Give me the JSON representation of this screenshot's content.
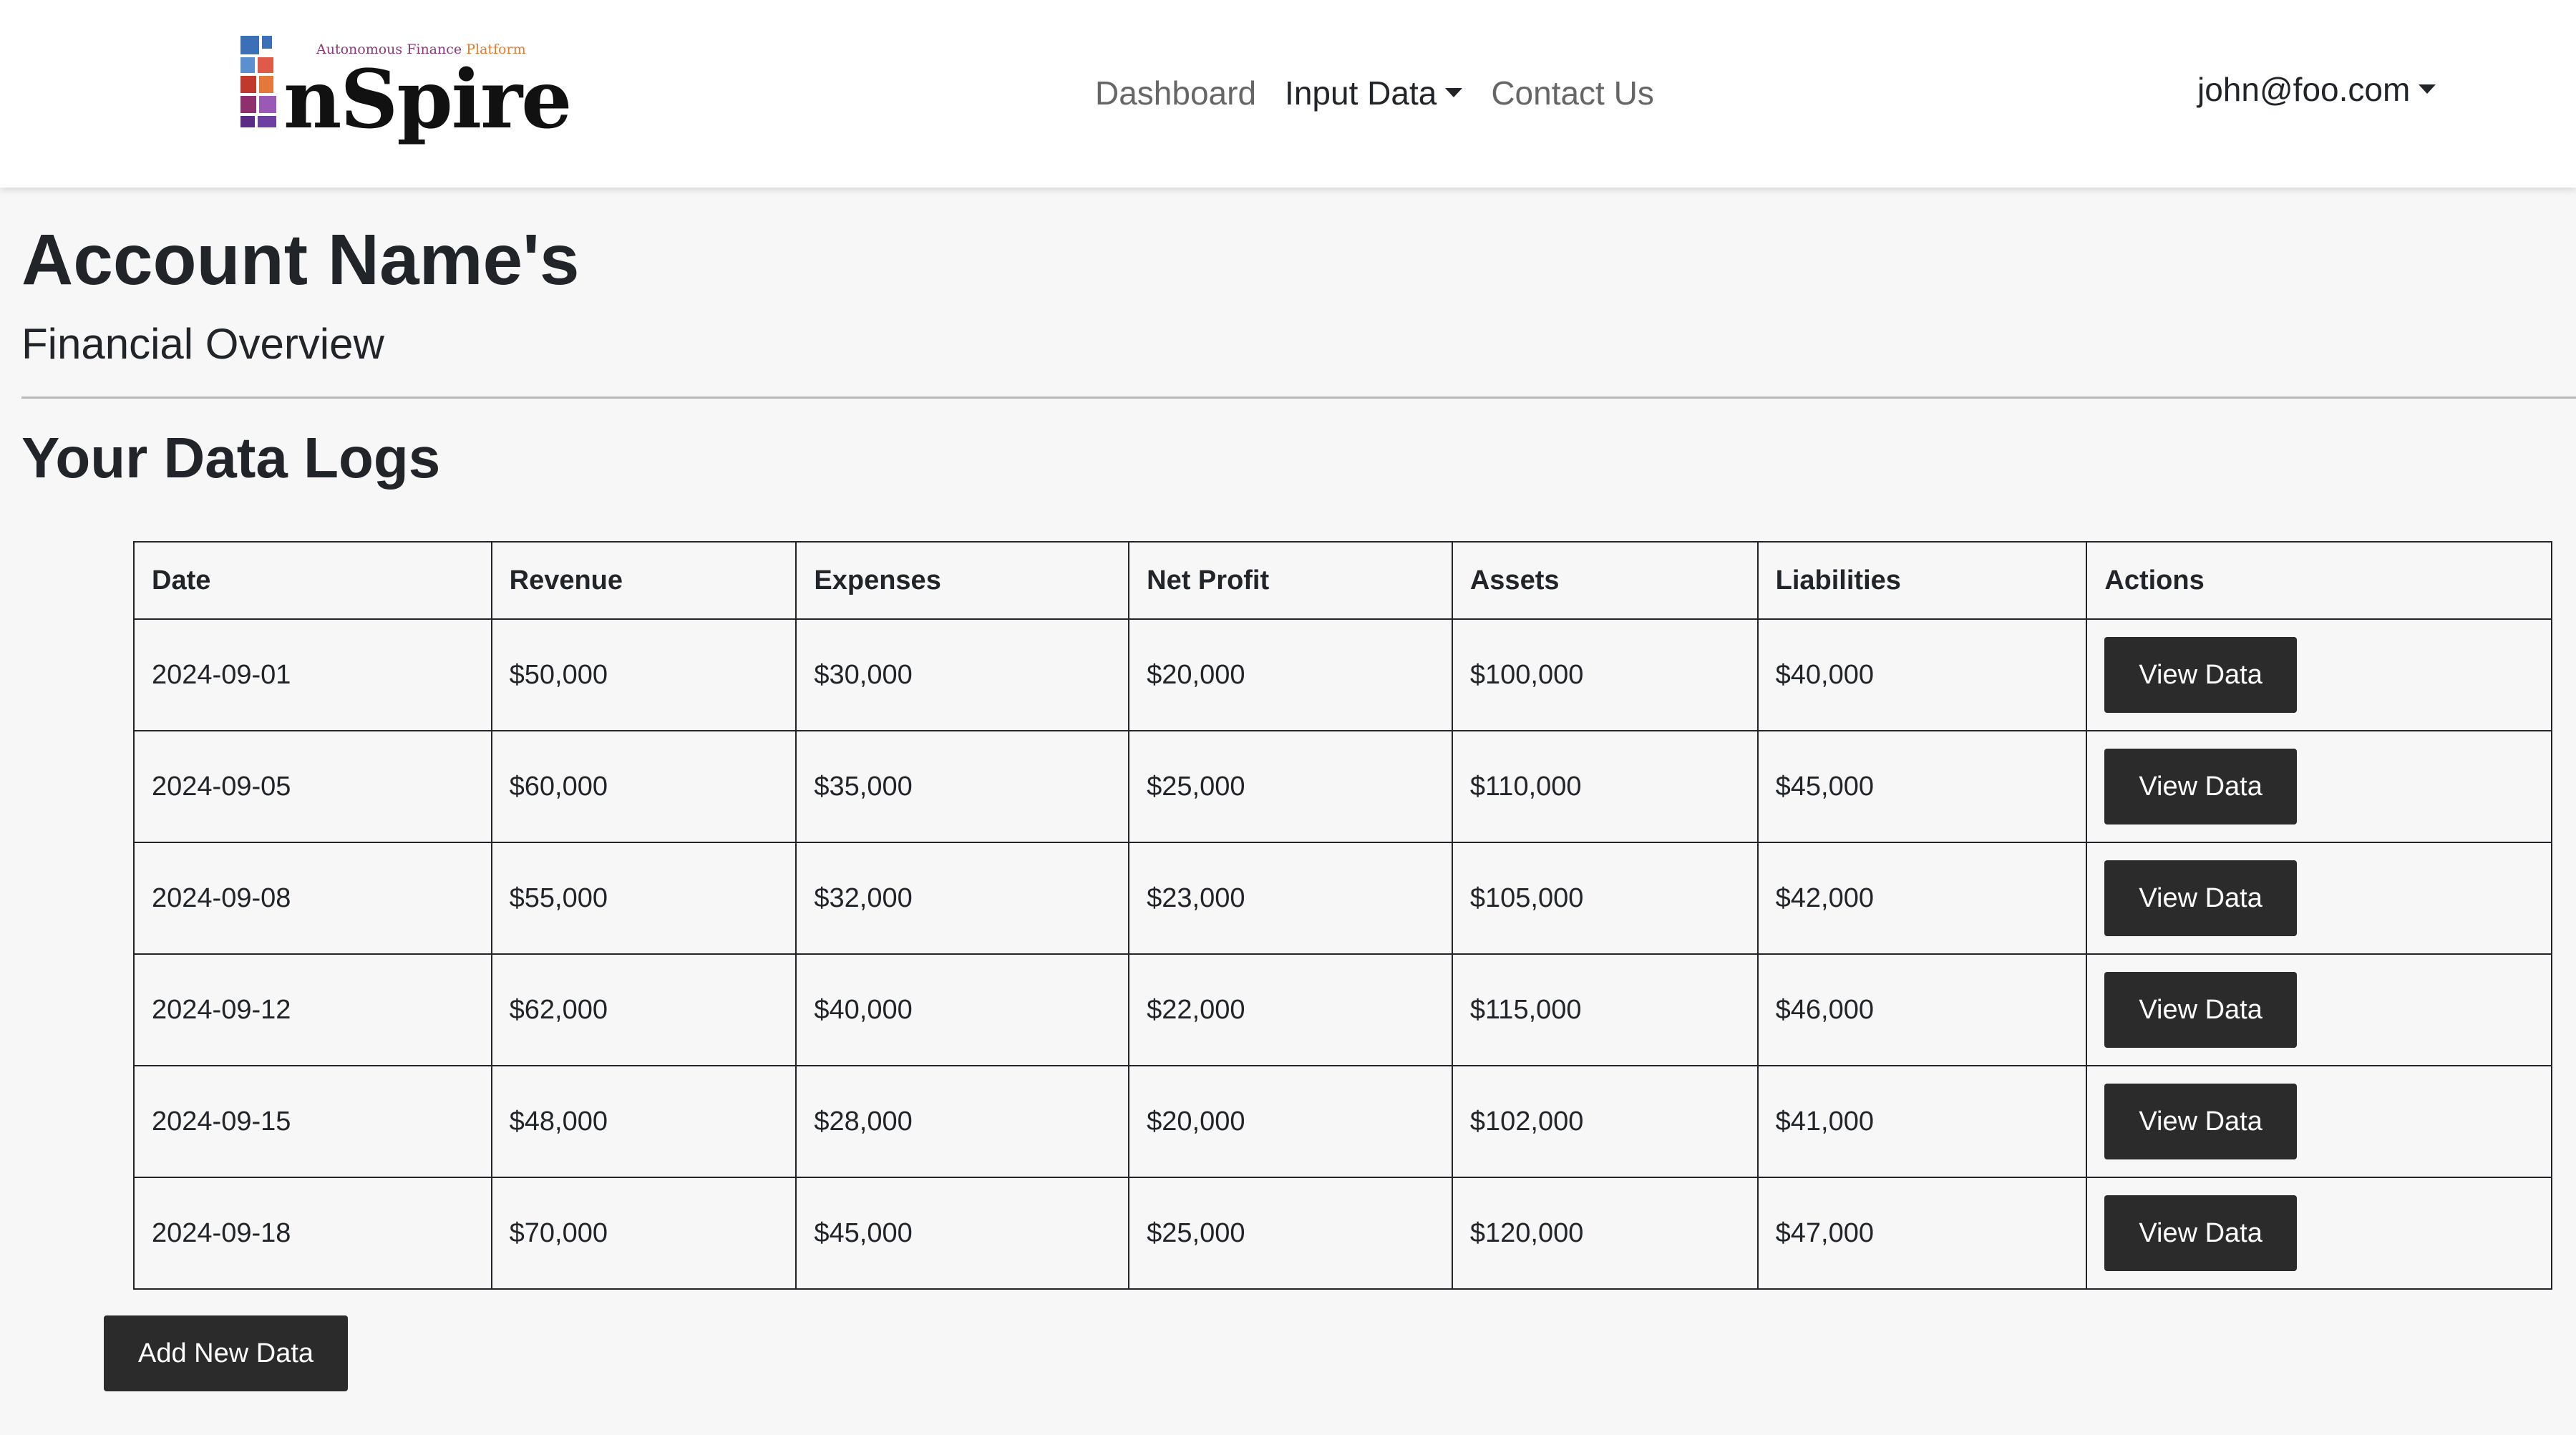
{
  "header": {
    "logo": {
      "tagline_part1": "Autonomous Finance",
      "tagline_part2": "Platform",
      "wordmark": "nSpire"
    },
    "nav": [
      {
        "label": "Dashboard",
        "active": false,
        "dropdown": false
      },
      {
        "label": "Input Data",
        "active": true,
        "dropdown": true
      },
      {
        "label": "Contact Us",
        "active": false,
        "dropdown": false
      }
    ],
    "user_email": "john@foo.com"
  },
  "page": {
    "title": "Account Name's",
    "subtitle": "Financial Overview",
    "section_title": "Your Data Logs"
  },
  "table": {
    "columns": [
      "Date",
      "Revenue",
      "Expenses",
      "Net Profit",
      "Assets",
      "Liabilities",
      "Actions"
    ],
    "rows": [
      [
        "2024-09-01",
        "$50,000",
        "$30,000",
        "$20,000",
        "$100,000",
        "$40,000"
      ],
      [
        "2024-09-05",
        "$60,000",
        "$35,000",
        "$25,000",
        "$110,000",
        "$45,000"
      ],
      [
        "2024-09-08",
        "$55,000",
        "$32,000",
        "$23,000",
        "$105,000",
        "$42,000"
      ],
      [
        "2024-09-12",
        "$62,000",
        "$40,000",
        "$22,000",
        "$115,000",
        "$46,000"
      ],
      [
        "2024-09-15",
        "$48,000",
        "$28,000",
        "$20,000",
        "$102,000",
        "$41,000"
      ],
      [
        "2024-09-18",
        "$70,000",
        "$45,000",
        "$25,000",
        "$120,000",
        "$47,000"
      ]
    ],
    "row_action_label": "View Data"
  },
  "actions": {
    "add_label": "Add New Data"
  },
  "colors": {
    "background": "#f7f7f7",
    "button": "#2b2b2b",
    "nav_muted": "#666666"
  }
}
